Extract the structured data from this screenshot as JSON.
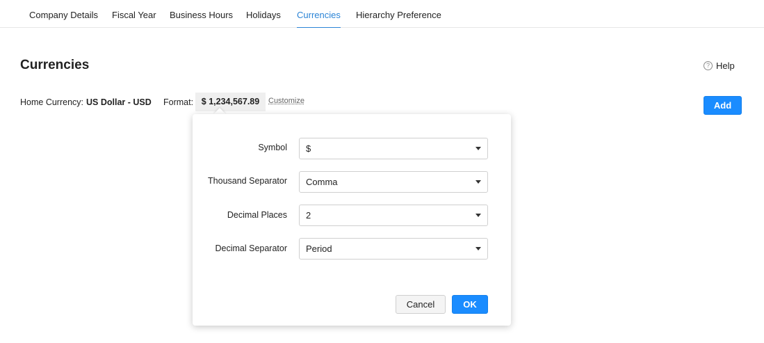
{
  "tabs": [
    {
      "label": "Company Details"
    },
    {
      "label": "Fiscal Year"
    },
    {
      "label": "Business Hours"
    },
    {
      "label": "Holidays"
    },
    {
      "label": "Currencies",
      "active": true
    },
    {
      "label": "Hierarchy Preference"
    }
  ],
  "page": {
    "title": "Currencies",
    "help_label": "Help",
    "help_icon": "question-circle-icon"
  },
  "home_currency": {
    "label": "Home Currency:",
    "value": "US Dollar - USD",
    "format_label": "Format:",
    "format_value": "$ 1,234,567.89",
    "customize_label": "Customize"
  },
  "actions": {
    "add_label": "Add"
  },
  "format_popover": {
    "fields": [
      {
        "label": "Symbol",
        "value": "$"
      },
      {
        "label": "Thousand Separator",
        "value": "Comma"
      },
      {
        "label": "Decimal Places",
        "value": "2"
      },
      {
        "label": "Decimal Separator",
        "value": "Period"
      }
    ],
    "cancel_label": "Cancel",
    "ok_label": "OK"
  },
  "colors": {
    "accent": "#2b84d6",
    "primary_button": "#1a8cff"
  }
}
